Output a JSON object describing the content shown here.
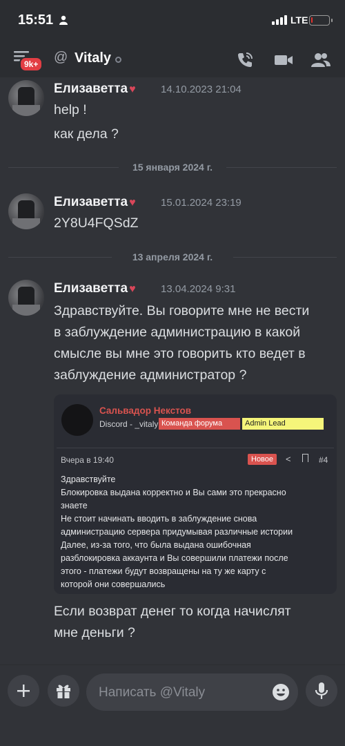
{
  "status_bar": {
    "time": "15:51",
    "network": "LTE",
    "battery_level": 0.1
  },
  "header": {
    "badge": "9k+",
    "at_symbol": "@",
    "title": "Vitaly"
  },
  "messages": [
    {
      "author": "Елизаветта",
      "heart": "♥",
      "timestamp": "14.10.2023 21:04",
      "lines": [
        "help !",
        "как дела ?"
      ]
    },
    {
      "author": "Елизаветта",
      "heart": "♥",
      "timestamp": "15.01.2024 23:19",
      "lines": [
        "2Y8U4FQSdZ"
      ]
    },
    {
      "author": "Елизаветта",
      "heart": "♥",
      "timestamp": "13.04.2024 9:31",
      "lines": [
        "Здравствуйте. Вы говорите мне не вести",
        "в заблуждение администрацию в какой",
        "смысле вы мне это говорить кто ведет в",
        "заблуждение администратор ?"
      ],
      "after": [
        "Если возврат денег то когда начислят",
        "мне деньги ?"
      ]
    }
  ],
  "dividers": [
    "15 января 2024 г.",
    "13 апреля 2024 г."
  ],
  "embed": {
    "name": "Сальвадор Некстов",
    "sub": "Discord - _vitaly",
    "tag_red": "Команда форума",
    "tag_yellow": "Admin Lead",
    "date": "Вчера в 19:40",
    "new_badge": "Новое",
    "share_icon": "<",
    "number": "#4",
    "body": [
      "Здравствуйте",
      "Блокировка выдана корректно и Вы сами это прекрасно",
      "знаете",
      "Не стоит начинать вводить в заблуждение снова",
      "администрацию сервера придумывая различные истории",
      "Далее, из-за того, что была выдана ошибочная",
      "разблокировка аккаунта и Вы совершили платежи после",
      "этого - платежи будут возвращены на ту же карту с",
      "которой они совершались"
    ]
  },
  "composer": {
    "placeholder": "Написать @Vitaly"
  },
  "colors": {
    "background": "#313338",
    "bar": "#2b2d31",
    "badge": "#e23e44",
    "tag_red": "#d9534f",
    "tag_yellow": "#f5f57a"
  }
}
